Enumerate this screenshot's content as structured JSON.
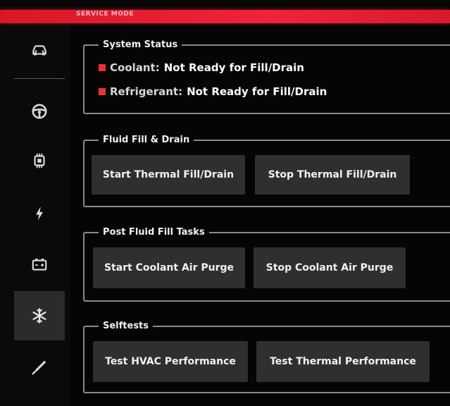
{
  "header": {
    "title": "SERVICE MODE",
    "accent_color": "#f0233a"
  },
  "sidebar": {
    "items": [
      {
        "icon": "car-icon",
        "active": false
      },
      {
        "icon": "steering-wheel-icon",
        "active": false
      },
      {
        "icon": "chip-icon",
        "active": false
      },
      {
        "icon": "lightning-icon",
        "active": false
      },
      {
        "icon": "battery-icon",
        "active": false
      },
      {
        "icon": "snowflake-icon",
        "active": true
      },
      {
        "icon": "wrench-icon",
        "active": false
      }
    ]
  },
  "system_status": {
    "title": "System Status",
    "items": [
      {
        "label": "Coolant:",
        "value": "Not Ready for Fill/Drain",
        "status_color": "#ef2f35"
      },
      {
        "label": "Refrigerant:",
        "value": "Not Ready for Fill/Drain",
        "status_color": "#ef2f35"
      }
    ]
  },
  "fluid_fill_drain": {
    "title": "Fluid Fill & Drain",
    "buttons": [
      "Start Thermal Fill/Drain",
      "Stop Thermal Fill/Drain"
    ]
  },
  "post_fluid_fill": {
    "title": "Post Fluid Fill Tasks",
    "buttons": [
      "Start Coolant Air Purge",
      "Stop Coolant Air Purge"
    ]
  },
  "selftests": {
    "title": "Selftests",
    "buttons": [
      "Test HVAC Performance",
      "Test Thermal Performance"
    ]
  }
}
